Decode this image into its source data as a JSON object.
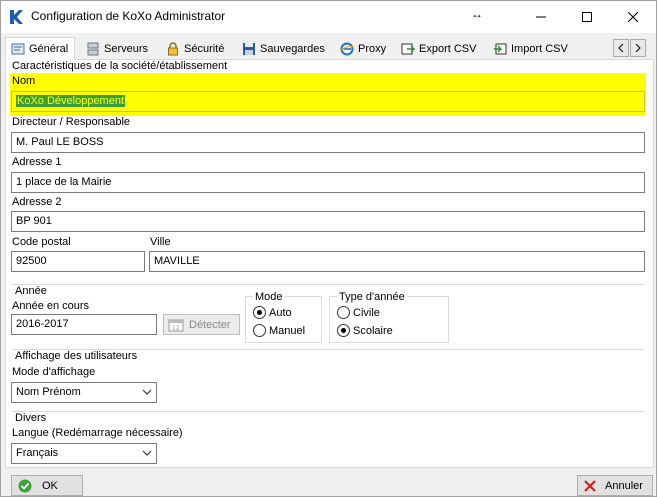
{
  "window": {
    "title": "Configuration de KoXo Administrator",
    "resize_glyph": "↔",
    "icons": {
      "app": "koxo-k-logo-icon",
      "minimize": "minimize-icon",
      "maximize": "maximize-icon",
      "close": "close-icon"
    }
  },
  "tabs": [
    {
      "label": "Général",
      "icon": "settings-panel-icon",
      "active": true
    },
    {
      "label": "Serveurs",
      "icon": "server-icon",
      "active": false
    },
    {
      "label": "Sécurité",
      "icon": "lock-icon",
      "active": false
    },
    {
      "label": "Sauvegardes",
      "icon": "floppy-disk-icon",
      "active": false
    },
    {
      "label": "Proxy",
      "icon": "globe-e-icon",
      "active": false
    },
    {
      "label": "Export CSV",
      "icon": "export-icon",
      "active": false
    },
    {
      "label": "Import CSV",
      "icon": "import-icon",
      "active": false
    }
  ],
  "company": {
    "section_title": "Caractéristiques de la société/établissement",
    "nom_label": "Nom",
    "nom_value": "KoXo Développement",
    "directeur_label": "Directeur / Responsable",
    "directeur_value": "M. Paul LE BOSS",
    "adresse1_label": "Adresse 1",
    "adresse1_value": "1 place de la Mairie",
    "adresse2_label": "Adresse 2",
    "adresse2_value": "BP 901",
    "cp_label": "Code postal",
    "cp_value": "92500",
    "ville_label": "Ville",
    "ville_value": "MAVILLE"
  },
  "annee": {
    "section_title": "Année",
    "en_cours_label": "Année en cours",
    "en_cours_value": "2016-2017",
    "detect_label": "Détecter",
    "mode_title": "Mode",
    "mode_options": [
      "Auto",
      "Manuel"
    ],
    "mode_selected": "Auto",
    "type_title": "Type d'année",
    "type_options": [
      "Civile",
      "Scolaire"
    ],
    "type_selected": "Scolaire"
  },
  "affichage": {
    "section_title": "Affichage des utilisateurs",
    "mode_label": "Mode d'affichage",
    "mode_value": "Nom Prénom"
  },
  "divers": {
    "section_title": "Divers",
    "langue_label": "Langue (Redémarrage nécessaire)",
    "langue_value": "Français"
  },
  "footer": {
    "ok_label": "OK",
    "cancel_label": "Annuler"
  },
  "colors": {
    "highlight": "#ffff00",
    "selection": "#3a9f3a",
    "accent": "#0078d7"
  }
}
